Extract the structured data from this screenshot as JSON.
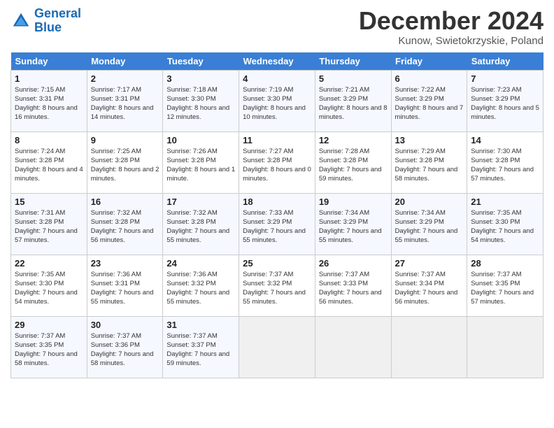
{
  "header": {
    "logo_line1": "General",
    "logo_line2": "Blue",
    "month_title": "December 2024",
    "location": "Kunow, Swietokrzyskie, Poland"
  },
  "weekdays": [
    "Sunday",
    "Monday",
    "Tuesday",
    "Wednesday",
    "Thursday",
    "Friday",
    "Saturday"
  ],
  "weeks": [
    [
      {
        "day": "1",
        "rise": "7:15 AM",
        "set": "3:31 PM",
        "daylight": "8 hours and 16 minutes."
      },
      {
        "day": "2",
        "rise": "7:17 AM",
        "set": "3:31 PM",
        "daylight": "8 hours and 14 minutes."
      },
      {
        "day": "3",
        "rise": "7:18 AM",
        "set": "3:30 PM",
        "daylight": "8 hours and 12 minutes."
      },
      {
        "day": "4",
        "rise": "7:19 AM",
        "set": "3:30 PM",
        "daylight": "8 hours and 10 minutes."
      },
      {
        "day": "5",
        "rise": "7:21 AM",
        "set": "3:29 PM",
        "daylight": "8 hours and 8 minutes."
      },
      {
        "day": "6",
        "rise": "7:22 AM",
        "set": "3:29 PM",
        "daylight": "8 hours and 7 minutes."
      },
      {
        "day": "7",
        "rise": "7:23 AM",
        "set": "3:29 PM",
        "daylight": "8 hours and 5 minutes."
      }
    ],
    [
      {
        "day": "8",
        "rise": "7:24 AM",
        "set": "3:28 PM",
        "daylight": "8 hours and 4 minutes."
      },
      {
        "day": "9",
        "rise": "7:25 AM",
        "set": "3:28 PM",
        "daylight": "8 hours and 2 minutes."
      },
      {
        "day": "10",
        "rise": "7:26 AM",
        "set": "3:28 PM",
        "daylight": "8 hours and 1 minute."
      },
      {
        "day": "11",
        "rise": "7:27 AM",
        "set": "3:28 PM",
        "daylight": "8 hours and 0 minutes."
      },
      {
        "day": "12",
        "rise": "7:28 AM",
        "set": "3:28 PM",
        "daylight": "7 hours and 59 minutes."
      },
      {
        "day": "13",
        "rise": "7:29 AM",
        "set": "3:28 PM",
        "daylight": "7 hours and 58 minutes."
      },
      {
        "day": "14",
        "rise": "7:30 AM",
        "set": "3:28 PM",
        "daylight": "7 hours and 57 minutes."
      }
    ],
    [
      {
        "day": "15",
        "rise": "7:31 AM",
        "set": "3:28 PM",
        "daylight": "7 hours and 57 minutes."
      },
      {
        "day": "16",
        "rise": "7:32 AM",
        "set": "3:28 PM",
        "daylight": "7 hours and 56 minutes."
      },
      {
        "day": "17",
        "rise": "7:32 AM",
        "set": "3:28 PM",
        "daylight": "7 hours and 55 minutes."
      },
      {
        "day": "18",
        "rise": "7:33 AM",
        "set": "3:29 PM",
        "daylight": "7 hours and 55 minutes."
      },
      {
        "day": "19",
        "rise": "7:34 AM",
        "set": "3:29 PM",
        "daylight": "7 hours and 55 minutes."
      },
      {
        "day": "20",
        "rise": "7:34 AM",
        "set": "3:29 PM",
        "daylight": "7 hours and 55 minutes."
      },
      {
        "day": "21",
        "rise": "7:35 AM",
        "set": "3:30 PM",
        "daylight": "7 hours and 54 minutes."
      }
    ],
    [
      {
        "day": "22",
        "rise": "7:35 AM",
        "set": "3:30 PM",
        "daylight": "7 hours and 54 minutes."
      },
      {
        "day": "23",
        "rise": "7:36 AM",
        "set": "3:31 PM",
        "daylight": "7 hours and 55 minutes."
      },
      {
        "day": "24",
        "rise": "7:36 AM",
        "set": "3:32 PM",
        "daylight": "7 hours and 55 minutes."
      },
      {
        "day": "25",
        "rise": "7:37 AM",
        "set": "3:32 PM",
        "daylight": "7 hours and 55 minutes."
      },
      {
        "day": "26",
        "rise": "7:37 AM",
        "set": "3:33 PM",
        "daylight": "7 hours and 56 minutes."
      },
      {
        "day": "27",
        "rise": "7:37 AM",
        "set": "3:34 PM",
        "daylight": "7 hours and 56 minutes."
      },
      {
        "day": "28",
        "rise": "7:37 AM",
        "set": "3:35 PM",
        "daylight": "7 hours and 57 minutes."
      }
    ],
    [
      {
        "day": "29",
        "rise": "7:37 AM",
        "set": "3:35 PM",
        "daylight": "7 hours and 58 minutes."
      },
      {
        "day": "30",
        "rise": "7:37 AM",
        "set": "3:36 PM",
        "daylight": "7 hours and 58 minutes."
      },
      {
        "day": "31",
        "rise": "7:37 AM",
        "set": "3:37 PM",
        "daylight": "7 hours and 59 minutes."
      },
      null,
      null,
      null,
      null
    ]
  ]
}
